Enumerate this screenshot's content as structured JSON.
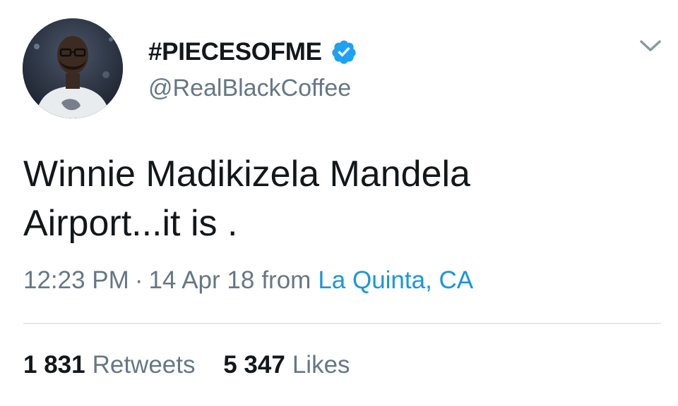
{
  "user": {
    "display_name": "#PIECESOFME",
    "handle": "@RealBlackCoffee",
    "verified_icon": "verified-badge-icon",
    "avatar": "profile-photo"
  },
  "menu_icon": "chevron-down-icon",
  "tweet": {
    "text_lines": [
      "Winnie Madikizela Mandela",
      "Airport...it is ."
    ],
    "time": "12:23 PM",
    "separator": "·",
    "date": "14 Apr 18",
    "from_label": "from",
    "location": "La Quinta, CA"
  },
  "stats": {
    "retweets_count": "1 831",
    "retweets_label": "Retweets",
    "likes_count": "5 347",
    "likes_label": "Likes"
  },
  "colors": {
    "text": "#14171a",
    "secondary": "#657786",
    "link": "#1b95e0",
    "verified": "#1da1f2",
    "divider": "#e1e8ed"
  }
}
